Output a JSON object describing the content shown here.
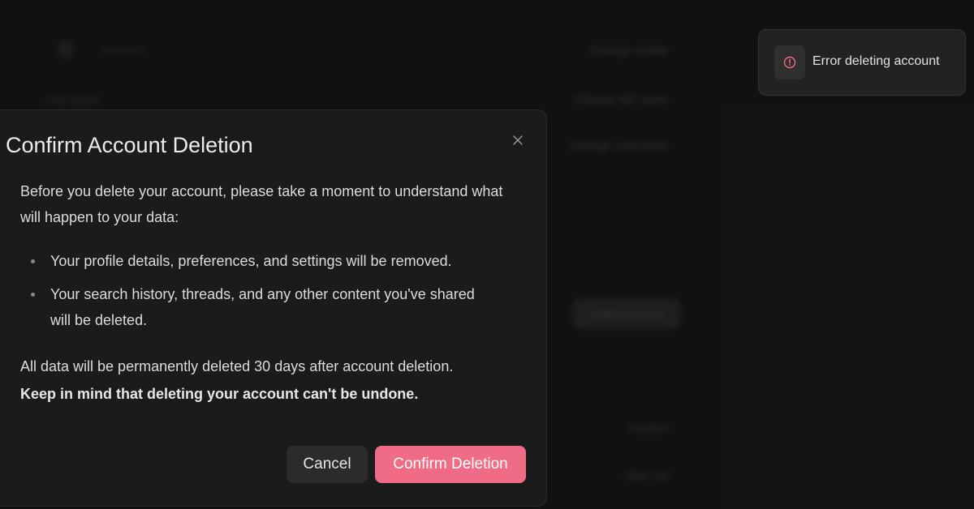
{
  "background": {
    "username": "username",
    "full_name_label": "Full Name",
    "links": [
      "Change avatar",
      "Change full name",
      "Change username"
    ],
    "delete_button": "Delete account",
    "contact_link": "Contact",
    "signout_link": "Sign out"
  },
  "modal": {
    "title": "Confirm Account Deletion",
    "intro": "Before you delete your account, please take a moment to understand what will happen to your data:",
    "bullets": [
      "Your profile details, preferences, and settings will be removed.",
      "Your search history, threads, and any other content you've shared will be deleted."
    ],
    "note": "All data will be permanently deleted 30 days after account deletion.",
    "warning": "Keep in mind that deleting your account can't be undone.",
    "cancel_label": "Cancel",
    "confirm_label": "Confirm Deletion",
    "close_icon": "close-icon"
  },
  "toast": {
    "message": "Error deleting account",
    "icon": "alert-circle-icon"
  },
  "colors": {
    "accent": "#f06b85",
    "error_icon": "#f06b85"
  }
}
